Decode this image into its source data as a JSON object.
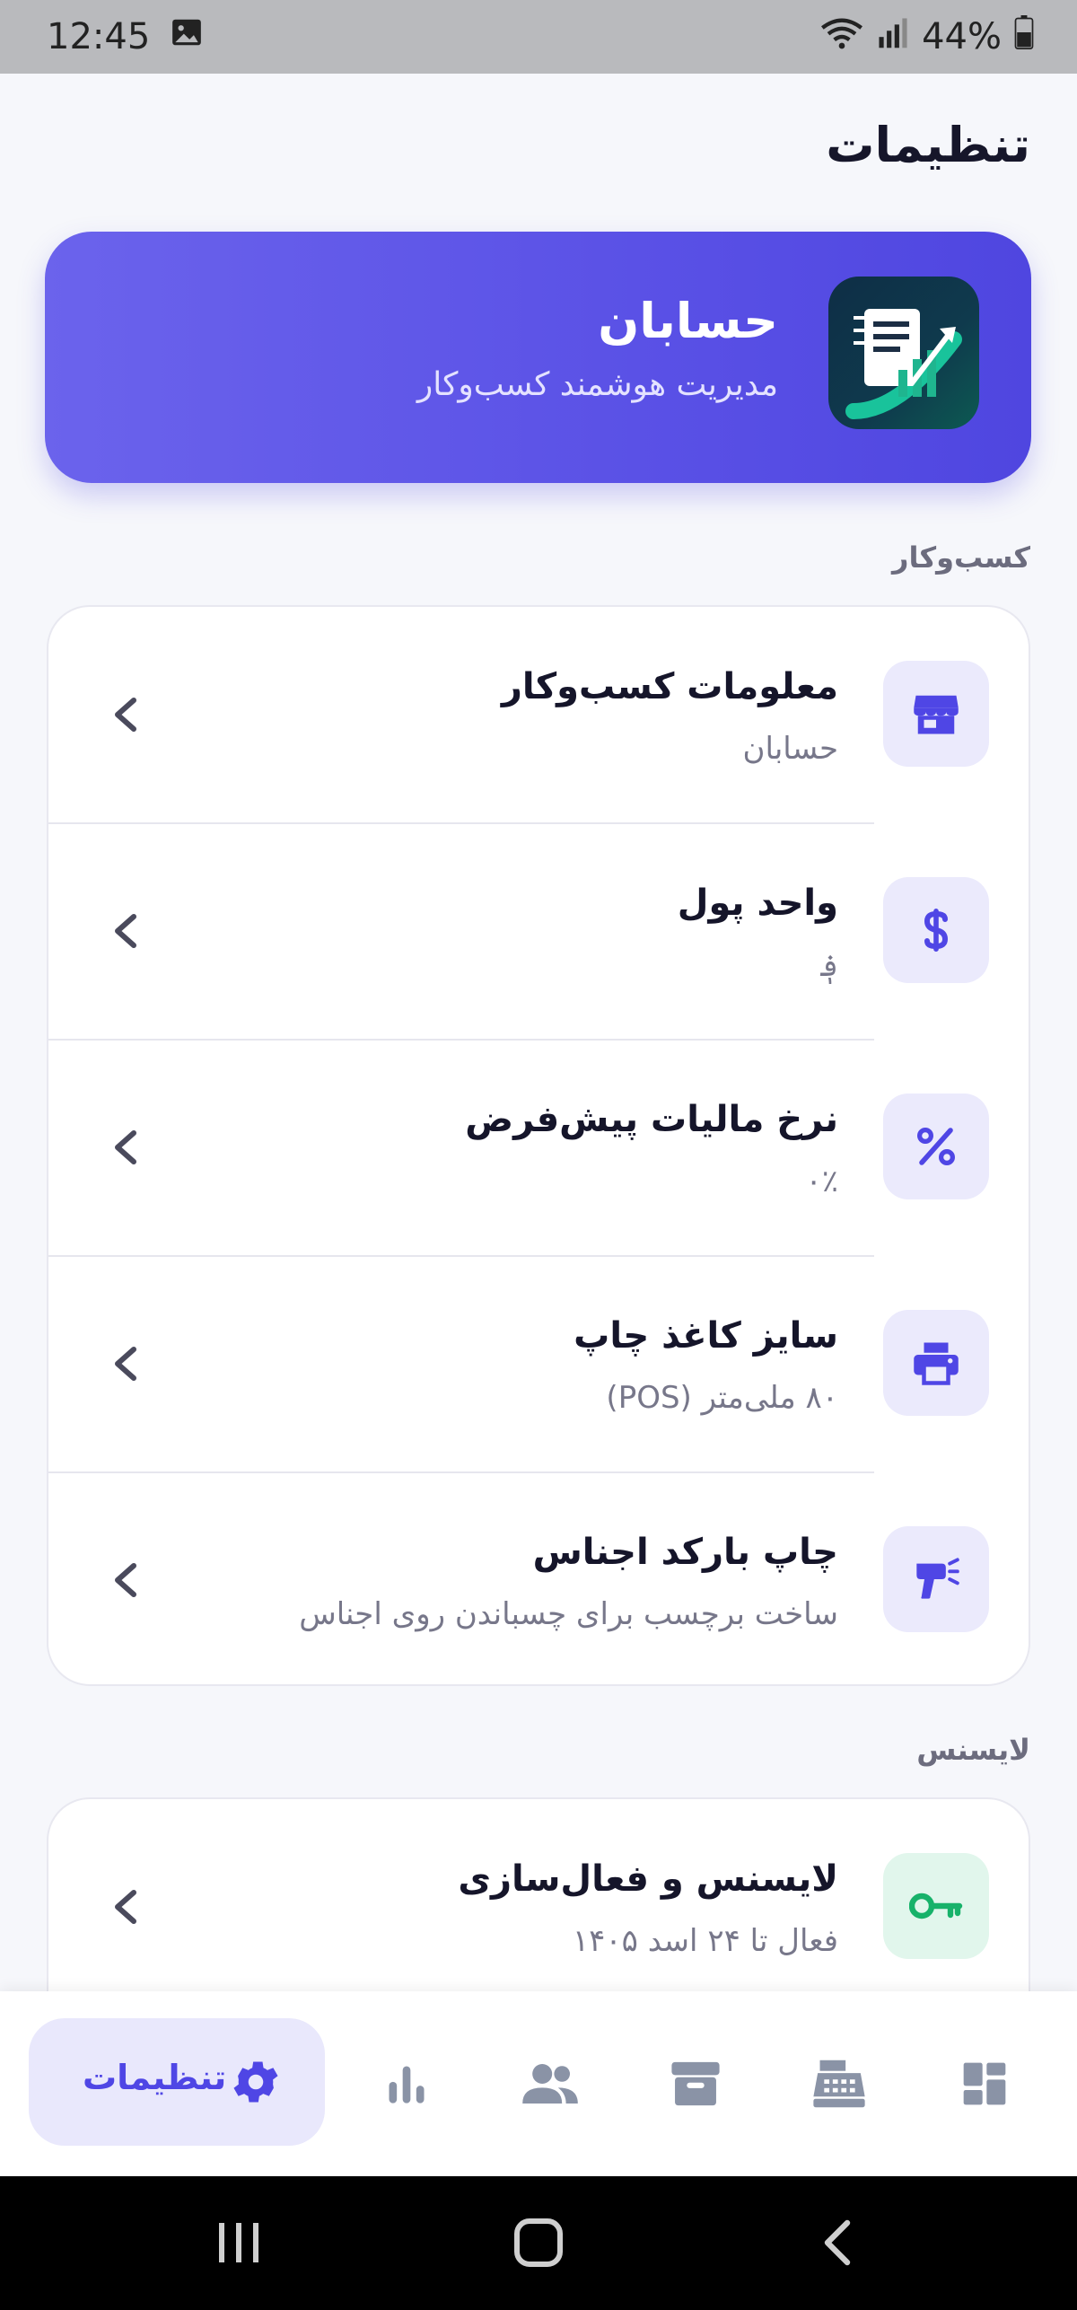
{
  "status_bar": {
    "time": "12:45",
    "battery": "44%"
  },
  "page": {
    "title": "تنظیمات"
  },
  "hero": {
    "title": "حسابان",
    "subtitle": "مدیریت هوشمند کسب‌وکار"
  },
  "sections": {
    "business_label": "کسب‌وکار",
    "license_label": "لایسنس"
  },
  "business_items": [
    {
      "title": "معلومات کسب‌وکار",
      "subtitle": "حسابان",
      "icon": "store-icon"
    },
    {
      "title": "واحد پول",
      "subtitle": "؋",
      "icon": "dollar-icon"
    },
    {
      "title": "نرخ مالیات پیش‌فرض",
      "subtitle": "۰٪",
      "icon": "percent-icon"
    },
    {
      "title": "سایز کاغذ چاپ",
      "subtitle": "۸۰ ملی‌متر (POS)",
      "icon": "printer-icon"
    },
    {
      "title": "چاپ بارکد اجناس",
      "subtitle": "ساخت برچسب برای چسباندن روی اجناس",
      "icon": "barcode-scanner-icon"
    }
  ],
  "license_items": [
    {
      "title": "لایسنس و فعال‌سازی",
      "subtitle": "فعال تا ۲۴ اسد ۱۴۰۵",
      "icon": "key-icon"
    }
  ],
  "bottom_nav": {
    "active_label": "تنظیمات",
    "items": [
      "settings-icon",
      "chart-icon",
      "people-icon",
      "archive-icon",
      "cash-register-icon",
      "dashboard-icon"
    ]
  },
  "colors": {
    "accent": "#4f46e5",
    "accent_light": "#ebeafc",
    "green": "#17b26a",
    "hero_gradient_start": "#6b63ec",
    "hero_gradient_end": "#4f46e0"
  }
}
